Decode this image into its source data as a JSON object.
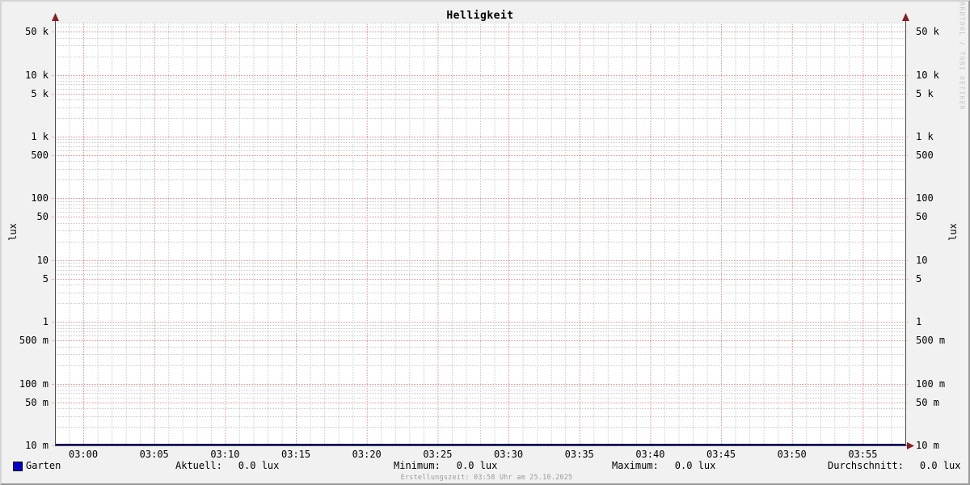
{
  "title": "Helligkeit",
  "watermark": "RRDTOOL / TOBI OETIKER",
  "footer": "Erstellungszeit: 03:58 Uhr am 25.10.2025",
  "y_axis": {
    "unit_left": "lux",
    "unit_right": "lux"
  },
  "legend": {
    "series": "Garten",
    "swatch_color": "#0000cc"
  },
  "stats": [
    {
      "label": "Aktuell:",
      "value": "0.0 lux"
    },
    {
      "label": "Minimum:",
      "value": "0.0 lux"
    },
    {
      "label": "Maximum:",
      "value": "0.0 lux"
    },
    {
      "label": "Durchschnitt:",
      "value": "0.0 lux"
    }
  ],
  "chart_data": {
    "type": "line",
    "title": "Helligkeit",
    "ylabel": "lux",
    "y_scale": "log",
    "ylim": [
      0.01,
      70000
    ],
    "x_start": "02:58",
    "x_end": "03:58",
    "x_tick_interval_minutes": 5,
    "x_minor_interval_minutes": 1,
    "x_ticks": [
      "03:00",
      "03:05",
      "03:10",
      "03:15",
      "03:20",
      "03:25",
      "03:30",
      "03:35",
      "03:40",
      "03:45",
      "03:50",
      "03:55"
    ],
    "y_ticks": [
      {
        "v": 50000,
        "label": "50 k"
      },
      {
        "v": 10000,
        "label": "10 k"
      },
      {
        "v": 5000,
        "label": "5 k"
      },
      {
        "v": 1000,
        "label": "1 k"
      },
      {
        "v": 500,
        "label": "500"
      },
      {
        "v": 100,
        "label": "100"
      },
      {
        "v": 50,
        "label": "50"
      },
      {
        "v": 10,
        "label": "10"
      },
      {
        "v": 5,
        "label": "5"
      },
      {
        "v": 1,
        "label": "1"
      },
      {
        "v": 0.5,
        "label": "500 m"
      },
      {
        "v": 0.1,
        "label": "100 m"
      },
      {
        "v": 0.05,
        "label": "50 m"
      },
      {
        "v": 0.01,
        "label": "10 m"
      }
    ],
    "series": [
      {
        "name": "Garten",
        "color": "#0000cc",
        "constant_value_lux": 0.0
      }
    ],
    "series_stats": {
      "aktuell": "0.0 lux",
      "minimum": "0.0 lux",
      "maximum": "0.0 lux",
      "durchschnitt": "0.0 lux"
    },
    "grid": {
      "minor_color": "#c9c9c9",
      "major_color": "#e08f8f",
      "axis_color": "#4a4a4a",
      "arrow_color": "#8a1f1f",
      "line_color": "#000066",
      "canvas_color": "#ffffff",
      "background_color": "#f1f1f1",
      "legend_on": true,
      "grid_on": true
    }
  }
}
